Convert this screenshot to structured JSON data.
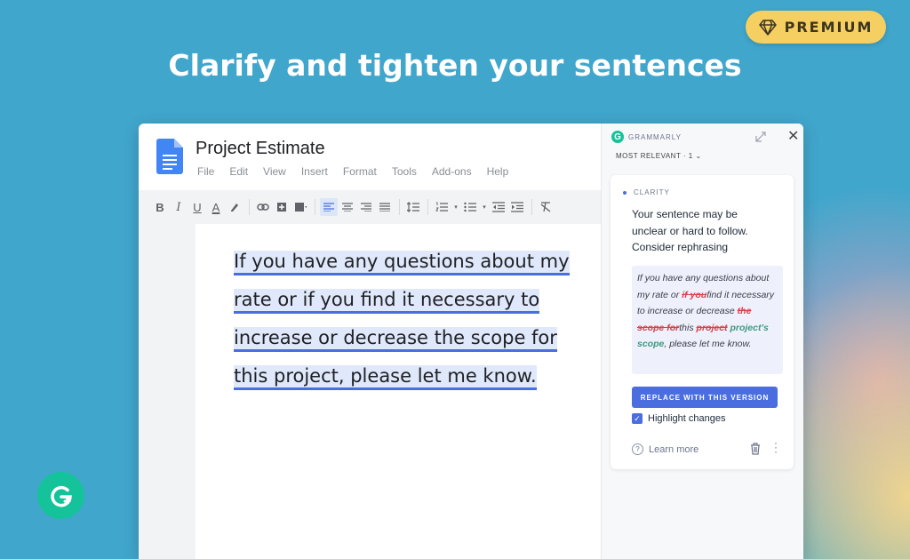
{
  "badge": {
    "label": "PREMIUM",
    "icon": "diamond-icon"
  },
  "headline": "Clarify and tighten your sentences",
  "doc": {
    "title": "Project Estimate",
    "menu": [
      "File",
      "Edit",
      "View",
      "Insert",
      "Format",
      "Tools",
      "Add-ons",
      "Help"
    ],
    "toolbar": {
      "bold": "B",
      "italic": "I",
      "underline": "U",
      "text_color": "A"
    },
    "lines": [
      "If you have any questions about my",
      "rate or if you find it necessary to",
      "increase or decrease the scope for",
      "this project, please let me know."
    ]
  },
  "panel": {
    "brand": "GRAMMARLY",
    "filter": "MOST RELEVANT · 1",
    "card": {
      "category": "CLARITY",
      "message": "Your sentence may be unclear or hard to follow. Consider rephrasing",
      "suggestion": {
        "p1": "If you have any questions about my rate or ",
        "del1": "if you",
        "p2": "find it necessary to increase or decrease ",
        "del2": "the scope for",
        "p3": "this ",
        "del3": "project",
        "ins1": "project's scope",
        "p4": ", please let me know."
      },
      "replace_button": "REPLACE WITH THIS VERSION",
      "highlight_label": "Highlight changes",
      "highlight_checked": true,
      "learn_more": "Learn more"
    }
  },
  "colors": {
    "accent": "#4a6ee0",
    "brand_green": "#15c39a",
    "background": "#41a6cc",
    "premium": "#f5cf62"
  }
}
